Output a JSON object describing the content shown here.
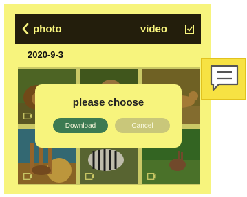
{
  "header": {
    "back_label": "photo",
    "video_label": "video",
    "back_icon": "chevron-left-icon",
    "select_icon": "checkbox-checked-icon"
  },
  "date_group": "2020-9-3",
  "thumbnails": [
    {
      "subject": "lion",
      "type": "video"
    },
    {
      "subject": "cheetah",
      "type": "photo"
    },
    {
      "subject": "lioness",
      "type": "photo"
    },
    {
      "subject": "giraffes",
      "type": "video"
    },
    {
      "subject": "zebras",
      "type": "video"
    },
    {
      "subject": "hare",
      "type": "video"
    }
  ],
  "dialog": {
    "title": "please choose",
    "download_label": "Download",
    "cancel_label": "Cancel"
  },
  "side_button": {
    "icon": "message-icon"
  },
  "colors": {
    "panel": "#f7f47d",
    "topbar": "#231e0c",
    "download": "#3c7a52",
    "cancel": "#c9c77a",
    "side_button": "#f7e243"
  }
}
